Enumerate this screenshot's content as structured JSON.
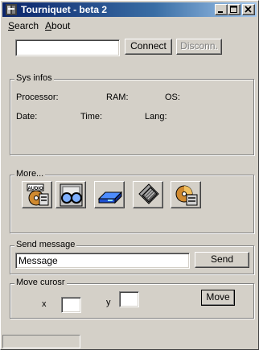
{
  "window": {
    "title": "Tourniquet - beta 2"
  },
  "menu": {
    "items": [
      {
        "accel": "S",
        "rest": "earch"
      },
      {
        "accel": "A",
        "rest": "bout"
      }
    ]
  },
  "connection": {
    "address_value": "",
    "connect_label": "Connect",
    "disconnect_label": "Disconn."
  },
  "sysinfo": {
    "title": "Sys infos",
    "processor_label": "Processor:",
    "ram_label": "RAM:",
    "os_label": "OS:",
    "date_label": "Date:",
    "time_label": "Time:",
    "lang_label": "Lang:"
  },
  "more": {
    "title": "More...",
    "tools": [
      {
        "name": "audio-icon",
        "badge": "AUDIO"
      },
      {
        "name": "webcam-glasses-icon"
      },
      {
        "name": "drive-icon"
      },
      {
        "name": "file-icon"
      },
      {
        "name": "cd-icon"
      }
    ]
  },
  "send": {
    "title": "Send message",
    "message_value": "Message",
    "send_label": "Send"
  },
  "cursor": {
    "title": "Move curosr",
    "x_label": "x",
    "y_label": "y",
    "x_value": "",
    "y_value": "",
    "move_label": "Move"
  },
  "colors": {
    "titlebar_start": "#0a246a",
    "titlebar_end": "#a6caf0",
    "face": "#d4d0c8"
  }
}
